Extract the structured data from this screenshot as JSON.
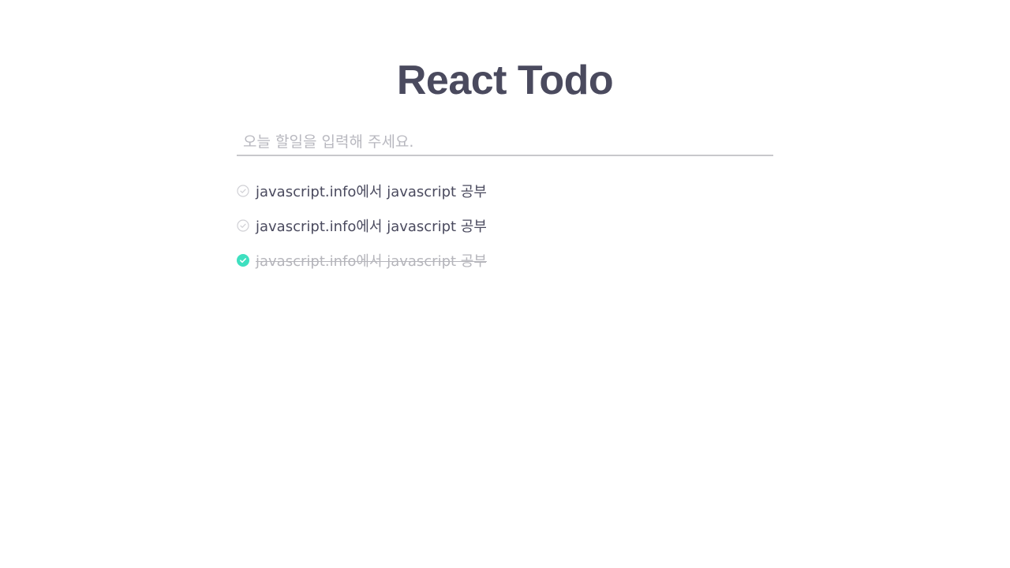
{
  "header": {
    "title": "React Todo"
  },
  "input": {
    "placeholder": "오늘 할일을 입력해 주세요.",
    "value": ""
  },
  "todos": [
    {
      "text": "javascript.info에서 javascript 공부",
      "done": false
    },
    {
      "text": "javascript.info에서 javascript 공부",
      "done": false
    },
    {
      "text": "javascript.info에서 javascript 공부",
      "done": true
    }
  ],
  "colors": {
    "title": "#4a4a5e",
    "text": "#4a4a5e",
    "done_text": "#b5b5bb",
    "check_done": "#3ee0c0",
    "check_idle": "#d0d0d5",
    "input_border": "#c8c8cc"
  },
  "icons": {
    "unchecked": "circle-check-outline-icon",
    "checked": "circle-check-filled-icon"
  }
}
